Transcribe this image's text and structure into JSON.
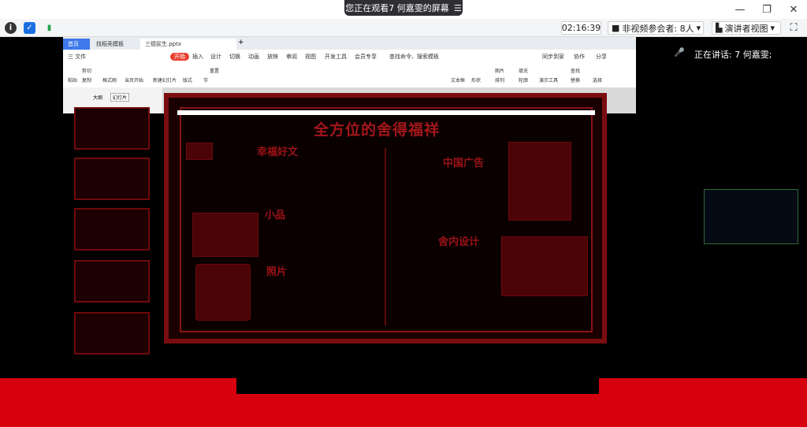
{
  "banner": {
    "text": "您正在观看7 何嘉雯的屏幕"
  },
  "toolbar": {
    "timer": "02:16:39",
    "nonvideo_label": "非视频参会者: 8人",
    "presenter_view_label": "演讲者视图"
  },
  "speaker": {
    "text": "正在讲话: 7 何嘉雯;"
  },
  "wps": {
    "tabs": [
      "首页",
      "找稻壳模板",
      "三德民生.pptx"
    ],
    "menu": [
      "三 文件",
      "开始",
      "插入",
      "设计",
      "切换",
      "动画",
      "放映",
      "审阅",
      "视图",
      "开发工具",
      "会员专享",
      "查找命令、搜索模板"
    ],
    "menu_right": [
      "同步到家",
      "协作",
      "分享"
    ],
    "ribbon": [
      "剪切",
      "粘贴",
      "复制",
      "格式刷",
      "当页开始",
      "新建幻灯片",
      "版式",
      "节",
      "重置",
      "文本框",
      "形状",
      "图片",
      "排列",
      "填充",
      "轮廓",
      "演示工具",
      "查找",
      "替换",
      "选择"
    ],
    "side_tabs": [
      "大纲",
      "幻灯片"
    ]
  },
  "slide": {
    "title": "全方位的舍得福祥",
    "labels": [
      "幸福好文",
      "中国广告",
      "小品",
      "舍内设计",
      "照片"
    ]
  },
  "colors": {
    "glitch_red": "#d6000f",
    "wps_start": "#e8402f"
  }
}
